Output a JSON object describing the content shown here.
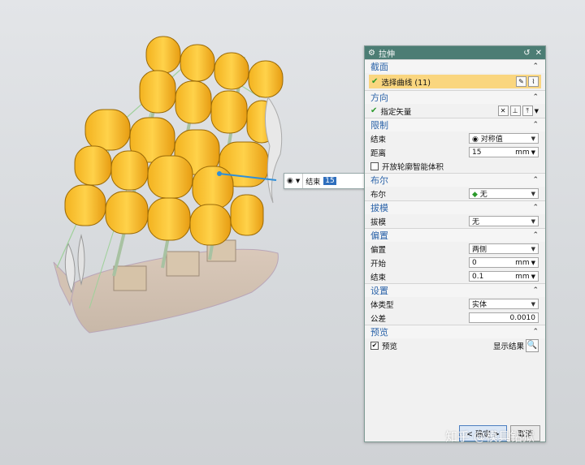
{
  "canvas": {
    "float": {
      "icon": "body-icon",
      "label": "结束",
      "value": "15"
    }
  },
  "dialog": {
    "title": "拉伸",
    "sections": {
      "section": {
        "title": "截面",
        "curves_label": "选择曲线 (11)"
      },
      "direction": {
        "title": "方向",
        "vector_label": "指定矢量"
      },
      "limits": {
        "title": "限制",
        "end_label": "结束",
        "end_value": "对称值",
        "distance_label": "距离",
        "distance_value": "15",
        "distance_unit": "mm",
        "open_profile_label": "开放轮廓智能体积"
      },
      "boolean": {
        "title": "布尔",
        "label": "布尔",
        "value": "无"
      },
      "draft": {
        "title": "拔模",
        "label": "拔模",
        "value": "无"
      },
      "offset": {
        "title": "偏置",
        "offset_label": "偏置",
        "offset_value": "两侧",
        "start_label": "开始",
        "start_value": "0",
        "start_unit": "mm",
        "end_label": "结束",
        "end_value": "0.1",
        "end_unit": "mm"
      },
      "settings": {
        "title": "设置",
        "body_type_label": "体类型",
        "body_type_value": "实体",
        "tolerance_label": "公差",
        "tolerance_value": "0.0010"
      },
      "preview": {
        "title": "预览",
        "preview_label": "预览",
        "show_result_label": "显示结果"
      }
    },
    "ok_label": "< 确定 >",
    "cancel_label": "取消"
  },
  "watermark": "知乎 @模具钻狱"
}
